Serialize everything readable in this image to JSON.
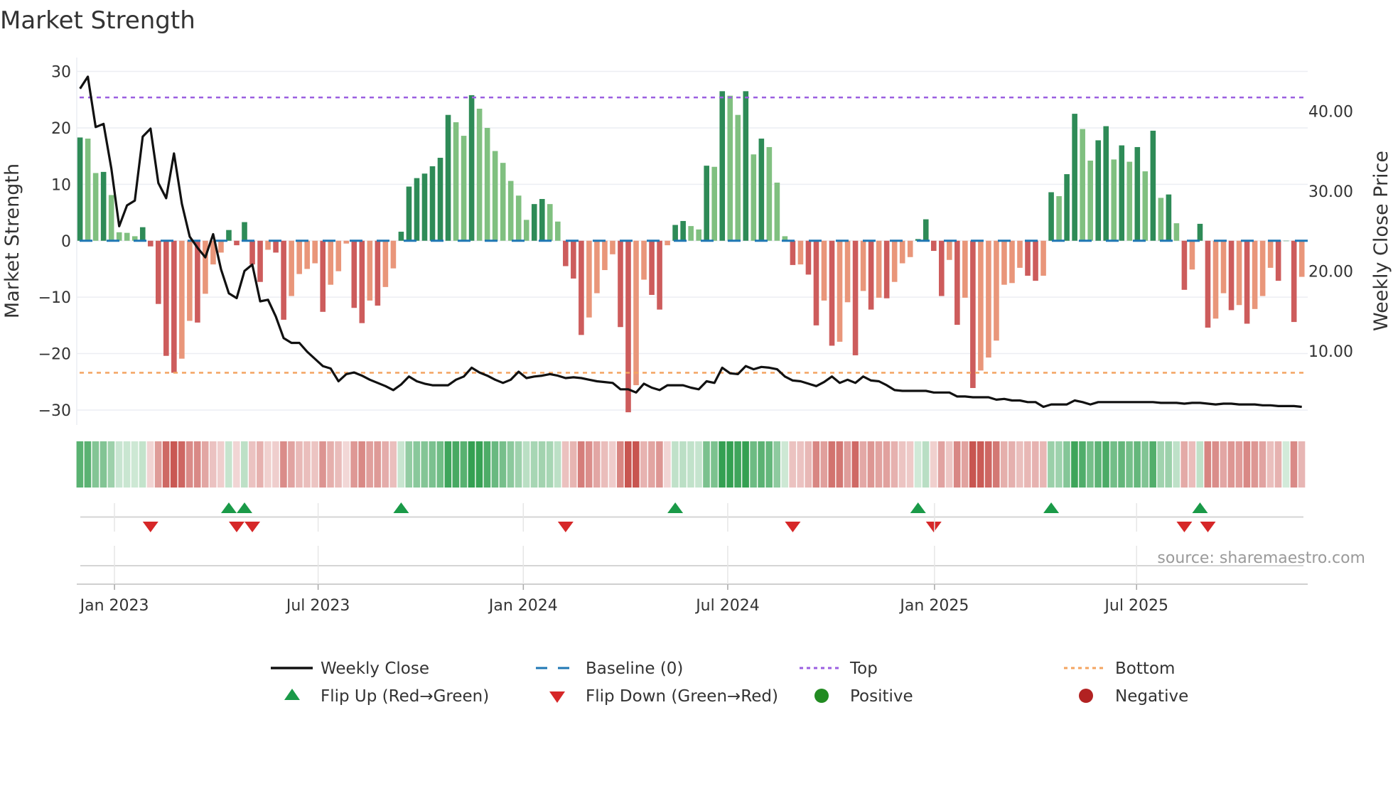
{
  "chart_data": {
    "type": "bar",
    "title": "Market Strength",
    "ylabel": "Market Strength",
    "y2label": "Weekly Close Price",
    "ylim": [
      -31.5,
      31.5
    ],
    "y2lim": [
      1.5,
      45.5
    ],
    "yticks": [
      "30",
      "20",
      "10",
      "0",
      "−10",
      "−20",
      "−30"
    ],
    "ytick_values": [
      30,
      20,
      10,
      0,
      -10,
      -20,
      -30
    ],
    "y2ticks": [
      "40.00",
      "30.00",
      "20.00",
      "10.00"
    ],
    "y2tick_values": [
      40,
      30,
      20,
      10
    ],
    "xticks": [
      "Jan 2023",
      "Jul 2023",
      "Jan 2024",
      "Jul 2024",
      "Jan 2025",
      "Jul 2025"
    ],
    "xtick_week_index": [
      4.4,
      30.4,
      56.6,
      82.7,
      109.1,
      134.9
    ],
    "top_level": 25.4,
    "bottom_level": -23.4,
    "baseline": 0,
    "source": "source: sharemaestro.com",
    "strength": [
      18.3,
      18.1,
      12.0,
      12.2,
      8.1,
      1.5,
      1.4,
      0.8,
      2.4,
      -1.0,
      -11.2,
      -20.4,
      -23.4,
      -20.9,
      -14.2,
      -14.5,
      -9.4,
      -4.2,
      -2.1,
      1.9,
      -0.8,
      3.3,
      -4.2,
      -7.3,
      -1.6,
      -2.1,
      -14.0,
      -9.8,
      -5.9,
      -5.0,
      -4.0,
      -12.6,
      -7.8,
      -5.4,
      -0.5,
      -11.9,
      -14.6,
      -10.6,
      -11.5,
      -8.2,
      -4.9,
      1.6,
      9.6,
      11.1,
      11.9,
      13.2,
      14.7,
      22.3,
      21.0,
      18.6,
      25.8,
      23.4,
      20.0,
      15.9,
      13.8,
      10.6,
      8.0,
      3.7,
      6.5,
      7.4,
      6.5,
      3.4,
      -4.5,
      -6.7,
      -16.7,
      -13.6,
      -9.3,
      -5.2,
      -2.4,
      -15.3,
      -30.4,
      -25.6,
      -6.9,
      -9.6,
      -12.2,
      -0.8,
      2.8,
      3.5,
      2.6,
      2.0,
      13.3,
      13.1,
      26.5,
      25.7,
      22.3,
      26.5,
      15.3,
      18.1,
      16.6,
      10.3,
      0.8,
      -4.3,
      -4.2,
      -6.0,
      -15.0,
      -10.6,
      -18.6,
      -17.9,
      -10.9,
      -20.3,
      -8.9,
      -12.2,
      -10.1,
      -10.2,
      -7.3,
      -4.0,
      -2.9,
      0.3,
      3.8,
      -1.8,
      -9.8,
      -3.4,
      -14.9,
      -10.1,
      -26.1,
      -23.0,
      -20.7,
      -17.7,
      -7.8,
      -7.5,
      -4.8,
      -6.2,
      -7.1,
      -6.2,
      8.6,
      7.9,
      11.8,
      22.5,
      19.8,
      14.2,
      17.8,
      20.3,
      14.4,
      16.9,
      14.0,
      16.6,
      12.3,
      19.5,
      7.6,
      8.2,
      3.1,
      -8.7,
      -5.1,
      3.0,
      -15.4,
      -13.8,
      -9.3,
      -12.3,
      -11.4,
      -14.7,
      -12.1,
      -9.8,
      -4.8,
      -7.1,
      0,
      -14.4,
      -6.4
    ],
    "shade": "DLLDLLLLDDDDDLLDLLLDDDDDLDDLLLLDLLLDDLDLLDDDDDDDLLDLLLLLLLDDLLDDDLLLLDDLLDDLDDLLDLDLLDLDLLLDLDDLDLLDLDLDLLLDDDDLDLDLLLLLLDDLDLDDLLDDLDLDLDLDLDLDDLLDLDLLLDDDL",
    "weekly_close": [
      42.8,
      44.3,
      38.0,
      38.4,
      32.8,
      25.6,
      28.2,
      28.8,
      36.8,
      37.8,
      31.0,
      29.1,
      34.7,
      28.4,
      24.3,
      22.9,
      21.7,
      24.6,
      20.2,
      17.2,
      16.6,
      20.0,
      20.8,
      16.2,
      16.4,
      14.3,
      11.6,
      11.0,
      11.0,
      9.9,
      9.0,
      8.1,
      7.8,
      6.2,
      7.1,
      7.3,
      6.9,
      6.4,
      6.0,
      5.6,
      5.1,
      5.8,
      6.8,
      6.2,
      5.9,
      5.7,
      5.7,
      5.7,
      6.4,
      6.8,
      7.9,
      7.3,
      6.9,
      6.4,
      6.0,
      6.4,
      7.4,
      6.6,
      6.8,
      6.9,
      7.1,
      6.9,
      6.6,
      6.7,
      6.6,
      6.4,
      6.2,
      6.1,
      6.0,
      5.2,
      5.2,
      4.8,
      5.9,
      5.4,
      5.1,
      5.7,
      5.7,
      5.7,
      5.4,
      5.2,
      6.2,
      6.0,
      7.9,
      7.2,
      7.1,
      8.1,
      7.7,
      8.0,
      7.9,
      7.7,
      6.8,
      6.3,
      6.2,
      5.9,
      5.6,
      6.1,
      6.8,
      6.0,
      6.4,
      6.0,
      6.8,
      6.3,
      6.2,
      5.7,
      5.1,
      5.0,
      5.0,
      5.0,
      5.0,
      4.8,
      4.8,
      4.8,
      4.3,
      4.3,
      4.2,
      4.2,
      4.2,
      3.9,
      4.0,
      3.8,
      3.8,
      3.6,
      3.6,
      3.0,
      3.3,
      3.3,
      3.3,
      3.8,
      3.6,
      3.3,
      3.6,
      3.6,
      3.6,
      3.6,
      3.6,
      3.6,
      3.6,
      3.6,
      3.5,
      3.5,
      3.5,
      3.4,
      3.5,
      3.5,
      3.4,
      3.3,
      3.4,
      3.4,
      3.3,
      3.3,
      3.3,
      3.2,
      3.2,
      3.1,
      3.1,
      3.1,
      3.0
    ],
    "legend": {
      "weekly_close": "Weekly Close",
      "baseline": "Baseline (0)",
      "top": "Top",
      "bottom": "Bottom",
      "flip_up": "Flip Up (Red→Green)",
      "flip_down": "Flip Down (Green→Red)",
      "positive": "Positive",
      "negative": "Negative"
    },
    "legend_placement": "bottom-center",
    "colors": {
      "pos_dark": "#2e8b57",
      "pos_light": "#80c080",
      "neg_dark": "#cd5c5c",
      "neg_light": "#e9967a",
      "line": "#111111",
      "baseline": "#1f77b4",
      "top": "#9b5fe0",
      "bottom": "#f4a460",
      "flip_up": "#1a9a48",
      "flip_down": "#d62728",
      "positive": "#228b22",
      "negative": "#b22222",
      "grid": "#eceef3"
    }
  }
}
